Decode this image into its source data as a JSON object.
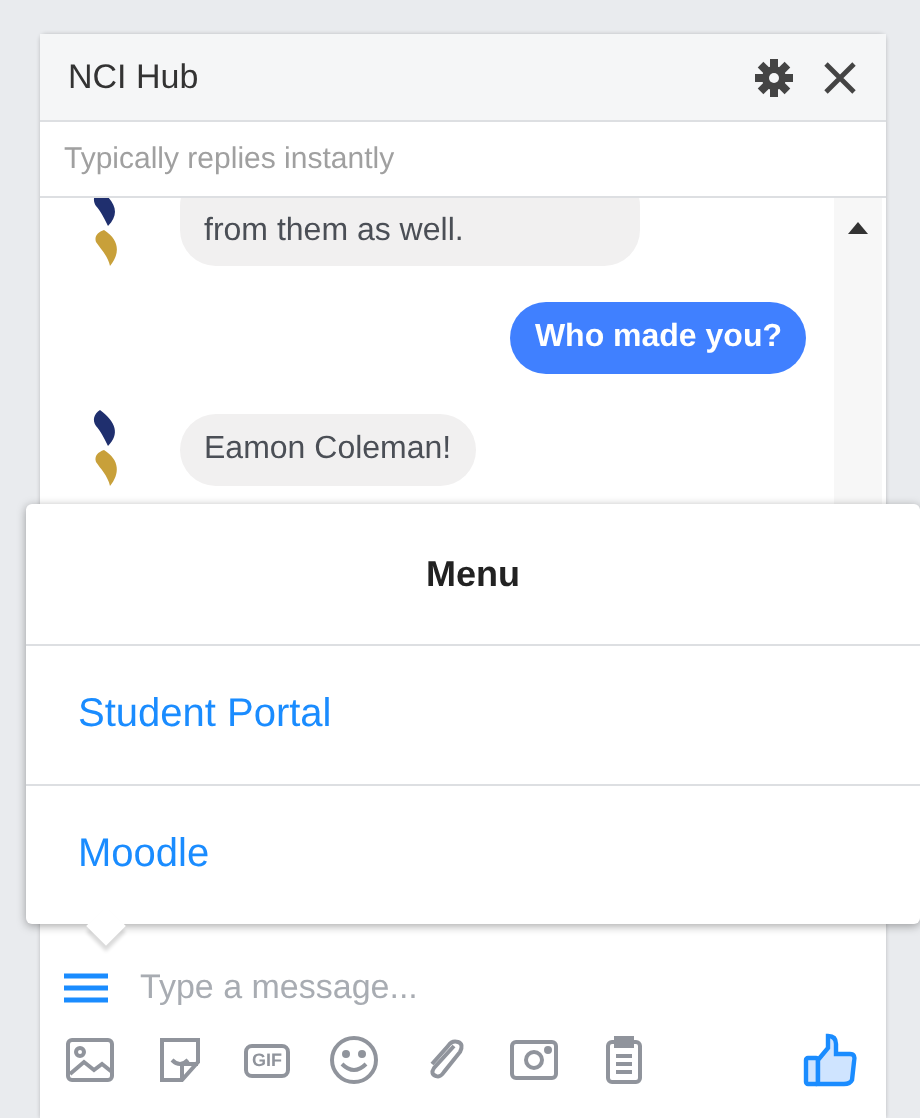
{
  "header": {
    "title": "NCI Hub",
    "subtitle": "Typically replies instantly"
  },
  "messages": [
    {
      "kind": "bot",
      "text": "from them as well.",
      "cut": true
    },
    {
      "kind": "user",
      "text": "Who made you?"
    },
    {
      "kind": "bot",
      "text": "Eamon Coleman!"
    }
  ],
  "menu": {
    "title": "Menu",
    "items": [
      "Student Portal",
      "Moodle"
    ]
  },
  "composer": {
    "placeholder": "Type a message...",
    "gif_label": "GIF"
  }
}
